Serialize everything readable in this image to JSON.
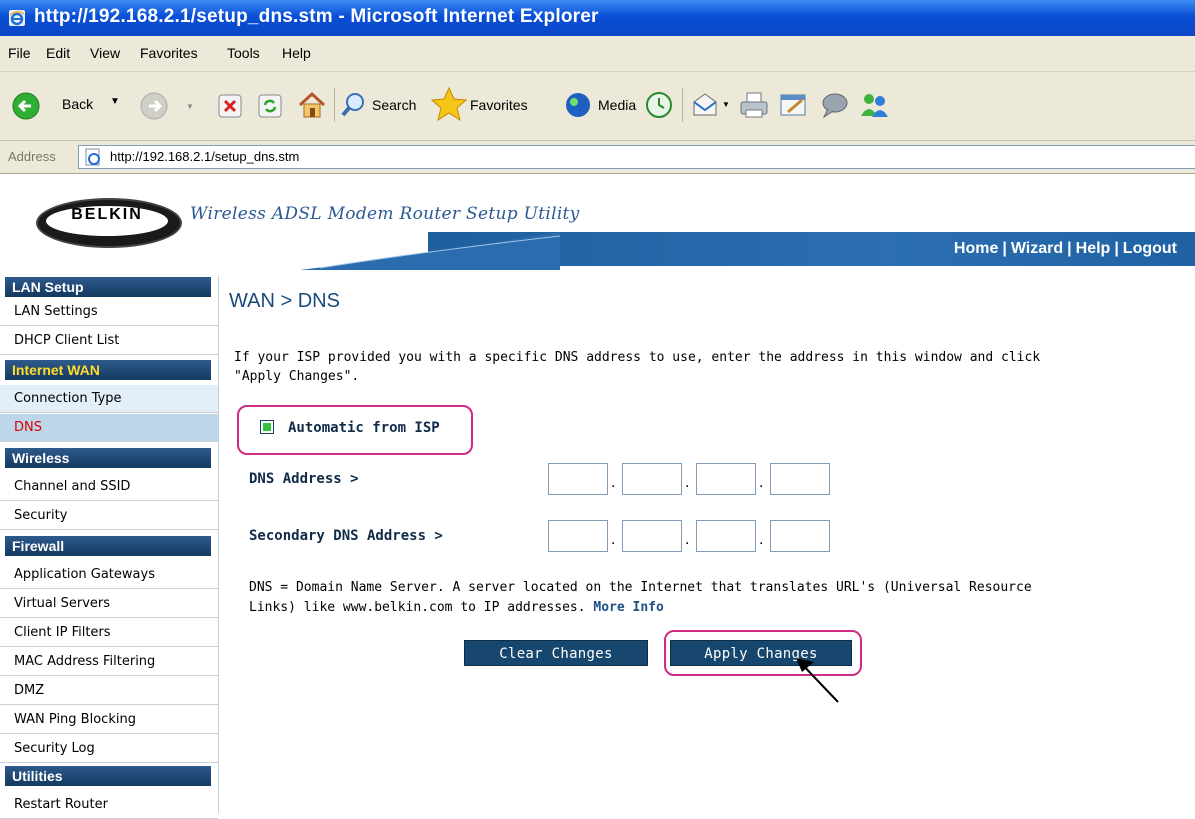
{
  "window": {
    "title": "http://192.168.2.1/setup_dns.stm - Microsoft Internet Explorer"
  },
  "menubar": {
    "items": [
      "File",
      "Edit",
      "View",
      "Favorites",
      "Tools",
      "Help"
    ]
  },
  "toolbar": {
    "back_label": "Back",
    "search_label": "Search",
    "favorites_label": "Favorites",
    "media_label": "Media"
  },
  "addressbar": {
    "label": "Address",
    "url": "http://192.168.2.1/setup_dns.stm"
  },
  "banner": {
    "logo_text": "BELKIN",
    "product_text": "Wireless ADSL Modem Router Setup Utility",
    "nav": [
      "Home",
      "Wizard",
      "Help",
      "Logout"
    ],
    "nav_sep": "|"
  },
  "sidebar": {
    "sections": [
      {
        "title": "LAN Setup",
        "items": [
          "LAN Settings",
          "DHCP Client List"
        ]
      },
      {
        "title": "Internet WAN",
        "items": [
          "Connection Type",
          "DNS"
        ]
      },
      {
        "title": "Wireless",
        "items": [
          "Channel and SSID",
          "Security"
        ]
      },
      {
        "title": "Firewall",
        "items": [
          "Application Gateways",
          "Virtual Servers",
          "Client IP Filters",
          "MAC Address Filtering",
          "DMZ",
          "WAN Ping Blocking",
          "Security Log"
        ]
      },
      {
        "title": "Utilities",
        "items": [
          "Restart Router"
        ]
      }
    ],
    "active_section": "Internet WAN",
    "selected_item": "DNS"
  },
  "main": {
    "title": "WAN > DNS",
    "intro": "If your ISP provided you with a specific DNS address to use, enter the address in this window and click \"Apply Changes\".",
    "auto_label": "Automatic from ISP",
    "auto_checked": true,
    "dns_label": "DNS Address >",
    "secondary_dns_label": "Secondary DNS Address >",
    "dns_octets": [
      "",
      "",
      "",
      ""
    ],
    "secondary_dns_octets": [
      "",
      "",
      "",
      ""
    ],
    "note": "DNS = Domain Name Server. A server located on the Internet that translates URL's (Universal Resource Links) like www.belkin.com to IP addresses.",
    "more_info": "More Info",
    "clear_button": "Clear Changes",
    "apply_button": "Apply Changes"
  },
  "colors": {
    "title_bar": "#0b4fd6",
    "sidebar_header": "#1b426b",
    "active_section_text": "#ffdc2c",
    "selected_item_text": "#dd0000",
    "highlight_ring": "#d02b83",
    "button": "#17476f"
  }
}
